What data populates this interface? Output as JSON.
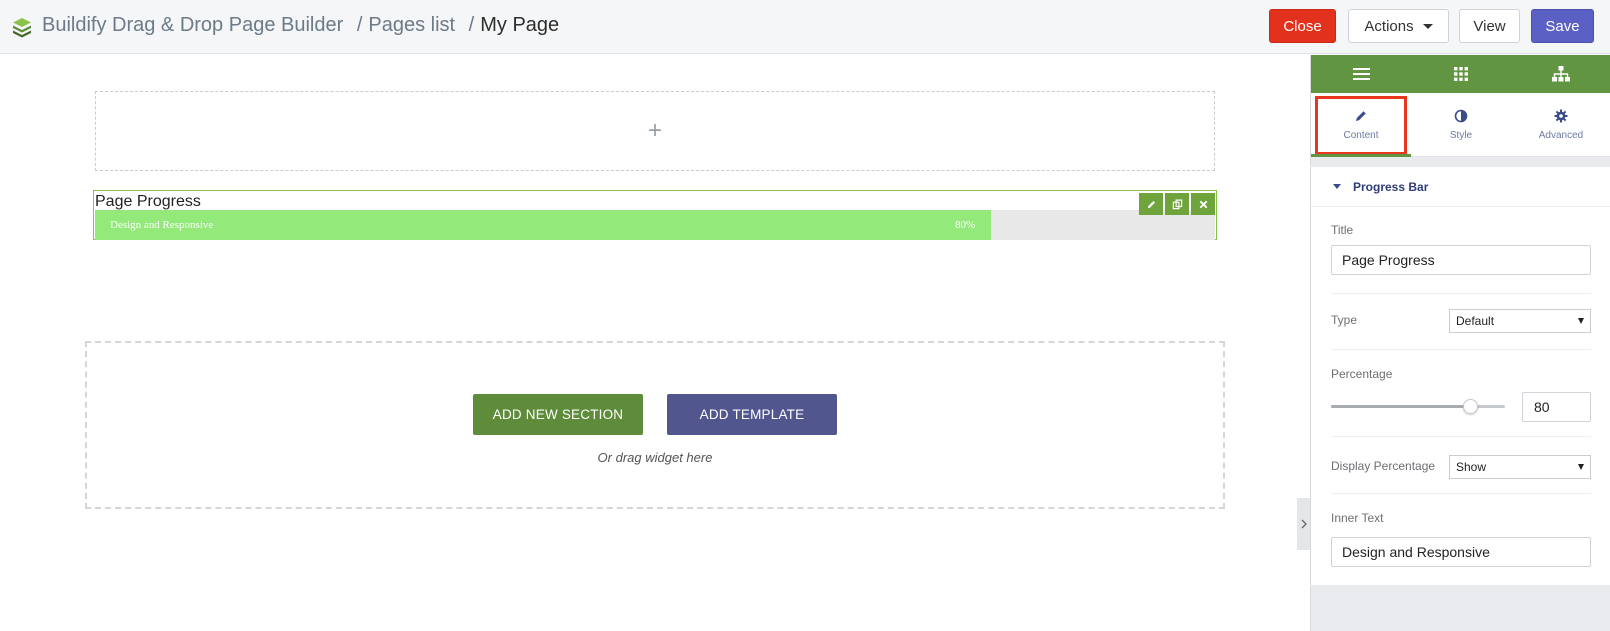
{
  "header": {
    "app_title": "Buildify Drag & Drop Page Builder",
    "sep1": "/",
    "crumb_pages": "Pages list",
    "sep2": "/",
    "crumb_current": "My Page",
    "close_label": "Close",
    "actions_label": "Actions",
    "view_label": "View",
    "save_label": "Save"
  },
  "canvas": {
    "plus_glyph": "+",
    "widget": {
      "title": "Page Progress",
      "inner_text": "Design and Responsive",
      "percent_label": "80%",
      "percent": 80
    },
    "add_new_section": "ADD NEW SECTION",
    "add_template": "ADD TEMPLATE",
    "drag_hint": "Or drag widget here"
  },
  "panel": {
    "top_icons": [
      "menu-icon",
      "grid-icon",
      "sitemap-icon"
    ],
    "tabs": [
      {
        "label": "Content",
        "icon": "pencil-icon",
        "active": true
      },
      {
        "label": "Style",
        "icon": "contrast-icon",
        "active": false
      },
      {
        "label": "Advanced",
        "icon": "gear-icon",
        "active": false
      }
    ],
    "section_title": "Progress Bar",
    "title_label": "Title",
    "title_value": "Page Progress",
    "type_label": "Type",
    "type_value": "Default",
    "percentage_label": "Percentage",
    "percentage_value": "80",
    "display_percentage_label": "Display Percentage",
    "display_percentage_value": "Show",
    "inner_text_label": "Inner Text",
    "inner_text_value": "Design and Responsive"
  },
  "colors": {
    "accent_green": "#629542",
    "bar_fill": "#93e97a",
    "close_red": "#e2321d",
    "save_purple": "#5b60c4",
    "template_purple": "#52568f",
    "highlight_red": "#e8371f"
  }
}
